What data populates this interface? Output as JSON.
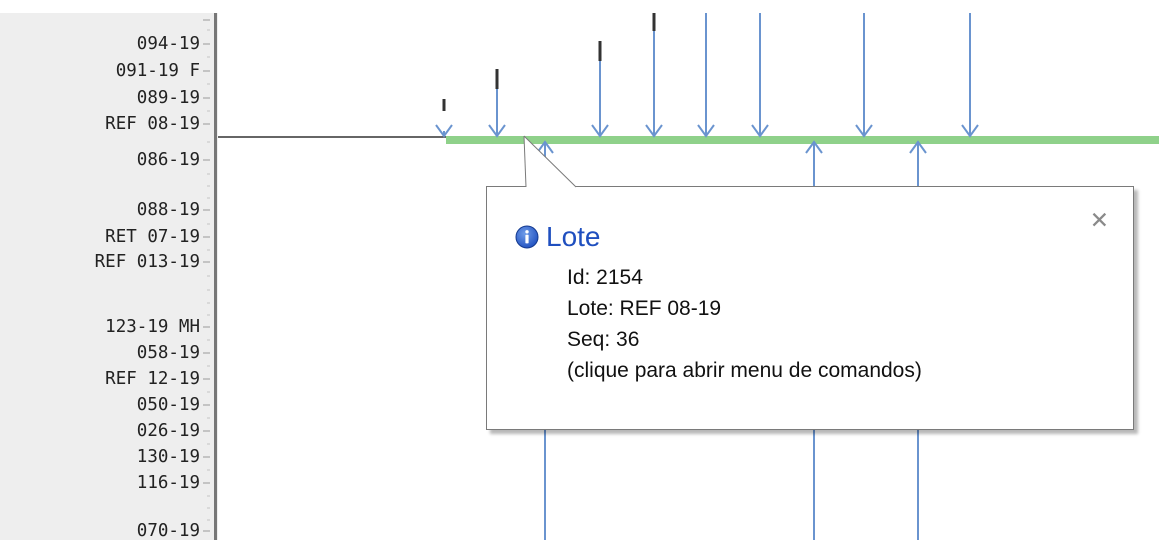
{
  "y_axis": {
    "labels": [
      "094-19",
      "091-19 F",
      "089-19",
      "REF 08-19",
      "086-19",
      "088-19",
      "RET 07-19",
      "REF 013-19",
      "123-19 MH",
      "058-19",
      "REF 12-19",
      "050-19",
      "026-19",
      "130-19",
      "116-19",
      "070-19"
    ]
  },
  "chart": {
    "highlight_color": "#8fd18a",
    "arrow_color": "#6a94cf",
    "marker_color": "#333333"
  },
  "tooltip": {
    "title": "Lote",
    "icon": "info-icon",
    "close_icon": "close-icon",
    "lines": [
      "Id: 2154",
      "Lote: REF 08-19",
      "Seq: 36",
      "(clique para abrir menu de comandos)"
    ]
  }
}
